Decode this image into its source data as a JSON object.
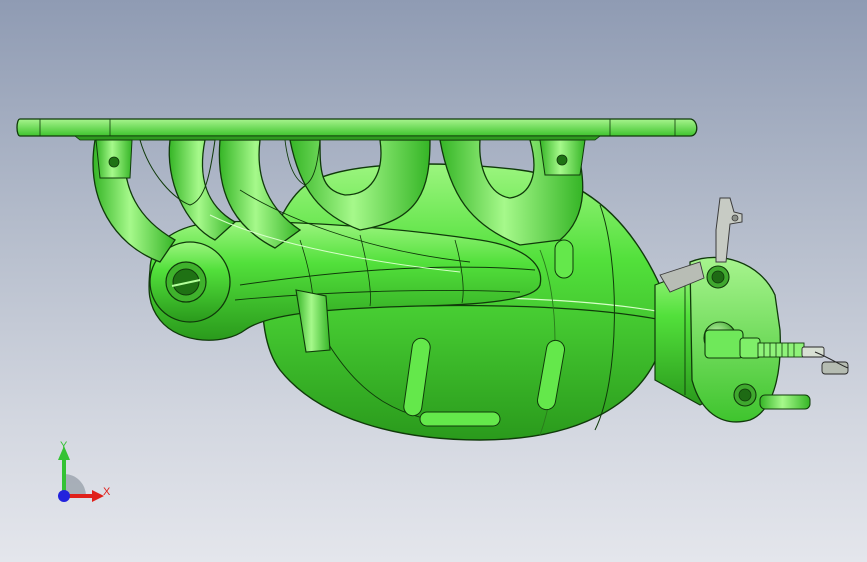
{
  "viewport": {
    "model": "exhaust-manifold-with-catalytic-converter",
    "colors": {
      "background_top": "#8f9bb3",
      "background_bottom": "#e4e6ec",
      "part": "#4fe03a",
      "part_dark": "#2e9a1f",
      "edge": "#103a0a",
      "sensor": "#c8d2c8"
    }
  },
  "triad": {
    "x_label": "X",
    "y_label": "Y",
    "x_color": "#e0201a",
    "y_color": "#34c234",
    "z_color": "#2222dd"
  }
}
